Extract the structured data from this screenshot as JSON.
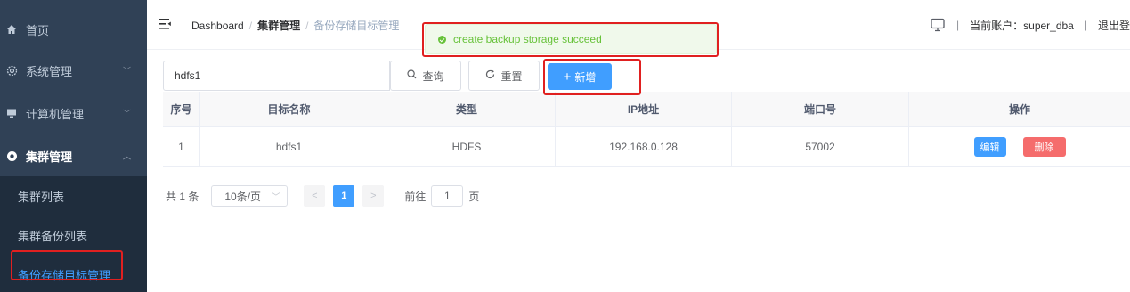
{
  "sidebar": {
    "items": [
      {
        "label": "首页",
        "icon": "home-icon"
      },
      {
        "label": "系统管理",
        "icon": "gear-icon",
        "arrow": "﹀"
      },
      {
        "label": "计算机管理",
        "icon": "monitor-icon",
        "arrow": "﹀"
      },
      {
        "label": "集群管理",
        "icon": "cluster-icon",
        "arrow": "︿"
      }
    ],
    "submenu": [
      {
        "label": "集群列表"
      },
      {
        "label": "集群备份列表"
      },
      {
        "label": "备份存储目标管理"
      }
    ],
    "bg_color": "#304156",
    "active_color": "#409eff"
  },
  "navbar": {
    "breadcrumb": [
      "Dashboard",
      "集群管理",
      "备份存储目标管理"
    ],
    "account_label": "当前账户：super_dba",
    "logout_label": "退出登"
  },
  "toast": {
    "message": "create backup storage succeed",
    "type": "success",
    "color": "#67c23a"
  },
  "search": {
    "value": "hdfs1",
    "query_label": "查询",
    "reset_label": "重置",
    "add_label": "新增"
  },
  "table": {
    "headers": [
      "序号",
      "目标名称",
      "类型",
      "IP地址",
      "端口号",
      "操作"
    ],
    "rows": [
      {
        "index": "1",
        "name": "hdfs1",
        "type": "HDFS",
        "ip": "192.168.0.128",
        "port": "57002",
        "edit_label": "编辑",
        "delete_label": "删除"
      }
    ]
  },
  "pagination": {
    "total": "共 1 条",
    "page_size": "10条/页",
    "current_page": "1",
    "goto_label": "前往",
    "goto_value": "1",
    "page_suffix": "页"
  },
  "annotation_color": "#e02020"
}
